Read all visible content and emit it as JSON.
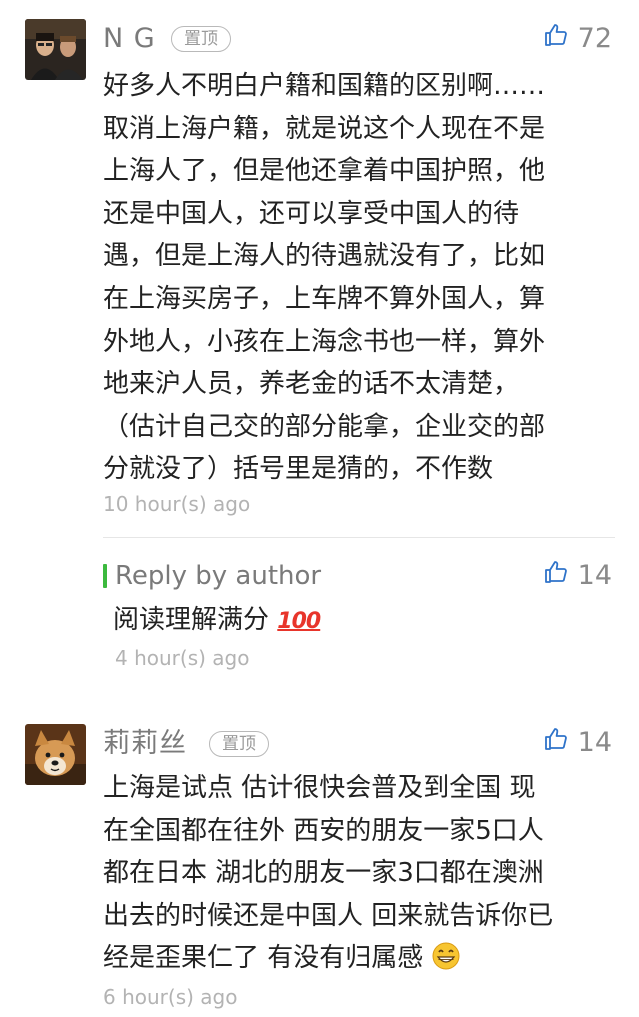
{
  "comments": [
    {
      "author": "N G",
      "pinned_label": "置顶",
      "likes": "72",
      "body_lines": [
        "好多人不明白户籍和国籍的区别啊……",
        "取消上海户籍，就是说这个人现在不是",
        "上海人了，但是他还拿着中国护照，他",
        "还是中国人，还可以享受中国人的待",
        "遇，但是上海人的待遇就没有了，比如",
        "在上海买房子，上车牌不算外国人，算",
        "外地人，小孩在上海念书也一样，算外",
        "地来沪人员，养老金的话不太清楚，",
        "（估计自己交的部分能拿，企业交的部",
        "分就没了）括号里是猜的，不作数"
      ],
      "time": "10 hour(s) ago",
      "reply": {
        "label": "Reply by author",
        "likes": "14",
        "text": "阅读理解满分",
        "emoji": "100",
        "time": "4 hour(s) ago"
      }
    },
    {
      "author": "莉莉丝",
      "pinned_label": "置顶",
      "likes": "14",
      "body_lines": [
        "上海是试点 估计很快会普及到全国 现",
        "在全国都在往外 西安的朋友一家5口人",
        "都在日本 湖北的朋友一家3口都在澳洲",
        "出去的时候还是中国人 回来就告诉你已",
        "经是歪果仁了 有没有归属感"
      ],
      "emoji": "grinning-face-emoji",
      "time": "6 hour(s) ago"
    }
  ],
  "colors": {
    "reply_bar": "#3cb93e",
    "meta_text": "#b3b3b3",
    "name_text": "#7a7a7a"
  }
}
